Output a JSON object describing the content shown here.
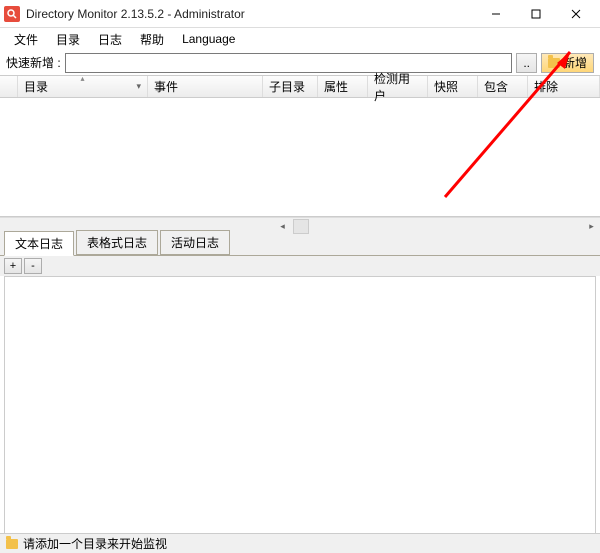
{
  "window": {
    "title": "Directory Monitor 2.13.5.2 - Administrator"
  },
  "menu": {
    "file": "文件",
    "directory": "目录",
    "log": "日志",
    "help": "帮助",
    "language": "Language"
  },
  "quickadd": {
    "label": "快速新增 :",
    "input_value": "",
    "browse": "..",
    "add": "新增"
  },
  "columns": {
    "directory": "目录",
    "event": "事件",
    "subdir": "子目录",
    "attribute": "属性",
    "detect_user": "检测用户",
    "snapshot": "快照",
    "include": "包含",
    "exclude": "排除"
  },
  "log_tabs": {
    "text": "文本日志",
    "table": "表格式日志",
    "activity": "活动日志"
  },
  "log_toolbar": {
    "add": "+",
    "remove": "-"
  },
  "status": {
    "message": "请添加一个目录来开始监视"
  }
}
